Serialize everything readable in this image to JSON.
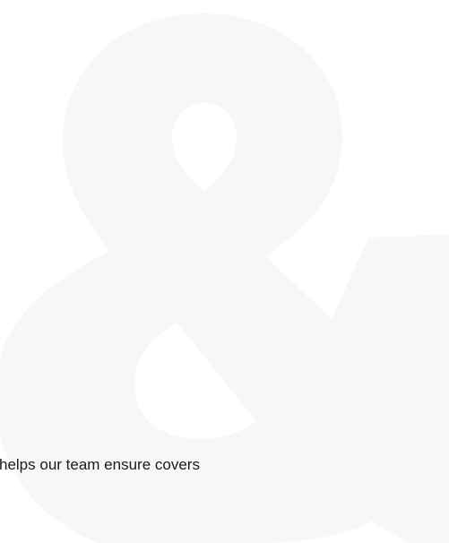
{
  "watermark": {
    "icon": "ampersand-icon",
    "color": "#f7f7f7"
  },
  "content": {
    "snippet_text": "helps our team ensure covers"
  }
}
